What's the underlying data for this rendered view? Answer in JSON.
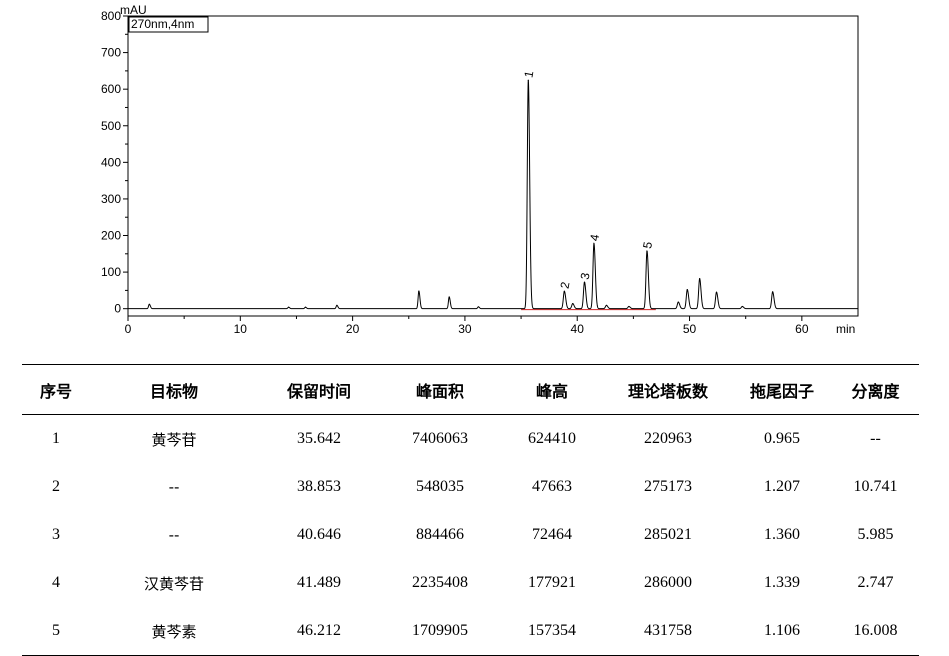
{
  "chart_data": {
    "type": "line",
    "yunit": "mAU",
    "xunit": "min",
    "legend_box": "270nm,4nm",
    "xlim": [
      0,
      65
    ],
    "ylim": [
      -20,
      800
    ],
    "xticks": [
      0,
      10,
      20,
      30,
      40,
      50,
      60
    ],
    "yticks": [
      0,
      100,
      200,
      300,
      400,
      500,
      600,
      700,
      800
    ],
    "baseline": 0,
    "peaks": [
      {
        "x": 1.9,
        "y": 12
      },
      {
        "x": 14.3,
        "y": 4
      },
      {
        "x": 15.8,
        "y": 4
      },
      {
        "x": 18.6,
        "y": 9
      },
      {
        "x": 25.9,
        "y": 48
      },
      {
        "x": 28.6,
        "y": 32
      },
      {
        "x": 31.2,
        "y": 5
      },
      {
        "x": 35.642,
        "y": 624.41,
        "label": "1"
      },
      {
        "x": 38.853,
        "y": 47.66,
        "label": "2"
      },
      {
        "x": 39.6,
        "y": 14
      },
      {
        "x": 40.646,
        "y": 72.46,
        "label": "3"
      },
      {
        "x": 41.489,
        "y": 177.92,
        "label": "4"
      },
      {
        "x": 42.6,
        "y": 9
      },
      {
        "x": 44.6,
        "y": 6
      },
      {
        "x": 46.212,
        "y": 157.35,
        "label": "5"
      },
      {
        "x": 49.0,
        "y": 18
      },
      {
        "x": 49.8,
        "y": 52
      },
      {
        "x": 50.9,
        "y": 82
      },
      {
        "x": 52.4,
        "y": 45
      },
      {
        "x": 54.7,
        "y": 6
      },
      {
        "x": 57.4,
        "y": 46
      }
    ]
  },
  "table": {
    "headers": [
      "序号",
      "目标物",
      "保留时间",
      "峰面积",
      "峰高",
      "理论塔板数",
      "拖尾因子",
      "分离度"
    ],
    "rows": [
      [
        "1",
        "黄芩苷",
        "35.642",
        "7406063",
        "624410",
        "220963",
        "0.965",
        "--"
      ],
      [
        "2",
        "--",
        "38.853",
        "548035",
        "47663",
        "275173",
        "1.207",
        "10.741"
      ],
      [
        "3",
        "--",
        "40.646",
        "884466",
        "72464",
        "285021",
        "1.360",
        "5.985"
      ],
      [
        "4",
        "汉黄芩苷",
        "41.489",
        "2235408",
        "177921",
        "286000",
        "1.339",
        "2.747"
      ],
      [
        "5",
        "黄芩素",
        "46.212",
        "1709905",
        "157354",
        "431758",
        "1.106",
        "16.008"
      ]
    ]
  }
}
